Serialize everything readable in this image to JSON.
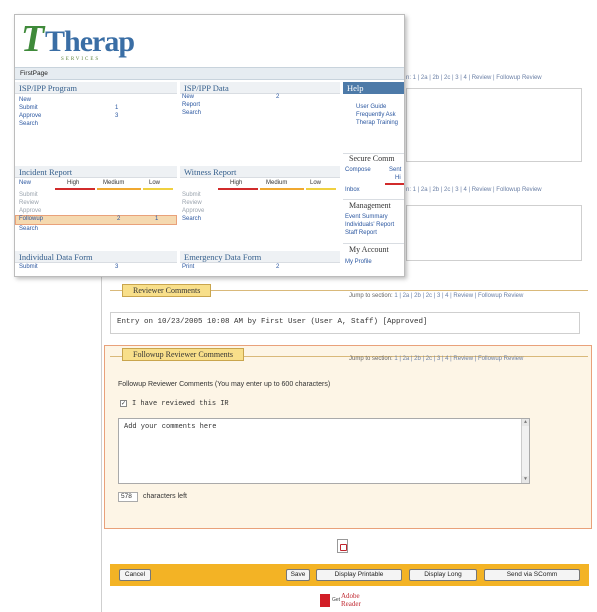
{
  "window": {
    "logo_text": "Therap",
    "logo_subtitle": "SERVICES",
    "breadcrumb": "FirstPage"
  },
  "panels": {
    "isp_program": {
      "title": "ISP/IPP Program",
      "items": [
        {
          "label": "New",
          "count": ""
        },
        {
          "label": "Submit",
          "count": "1"
        },
        {
          "label": "Approve",
          "count": "3"
        },
        {
          "label": "Search",
          "count": ""
        }
      ]
    },
    "isp_data": {
      "title": "ISP/IPP Data",
      "items": [
        {
          "label": "New",
          "count": "2"
        },
        {
          "label": "Report",
          "count": ""
        },
        {
          "label": "Search",
          "count": ""
        }
      ]
    },
    "incident_report": {
      "title": "Incident Report",
      "severity": [
        "High",
        "Medium",
        "Low"
      ],
      "items": [
        {
          "label": "New"
        },
        {
          "label": "Submit"
        },
        {
          "label": "Review"
        },
        {
          "label": "Approve"
        },
        {
          "label": "Followup",
          "high": "",
          "medium": "2",
          "low": "1"
        },
        {
          "label": "Search"
        }
      ]
    },
    "witness_report": {
      "title": "Witness Report",
      "severity": [
        "High",
        "Medium",
        "Low"
      ],
      "items": [
        {
          "label": "Submit"
        },
        {
          "label": "Review"
        },
        {
          "label": "Approve"
        },
        {
          "label": "Search"
        }
      ]
    },
    "individual_data": {
      "title": "Individual Data Form",
      "items": [
        {
          "label": "Submit",
          "count": "3"
        }
      ]
    },
    "emergency_data": {
      "title": "Emergency Data Form",
      "items": [
        {
          "label": "Print",
          "count": "2"
        }
      ]
    }
  },
  "sidebar": {
    "help": {
      "title": "Help",
      "links": [
        "User Guide",
        "Frequently Ask",
        "Therap Training"
      ]
    },
    "secure_comm": {
      "title": "Secure Comm",
      "links": [
        "Compose",
        "Sent",
        "Inbox"
      ],
      "extra": "Hi"
    },
    "management": {
      "title": "Management",
      "links": [
        "Event Summary",
        "Individuals' Report",
        "Staff Report"
      ]
    },
    "my_account": {
      "title": "My Account",
      "links": [
        "My Profile"
      ]
    }
  },
  "form": {
    "jump_prefix_partial": "n: 1 | 2a | 2b | 2c | 3 | 4 | Review | Followup Review",
    "jump_label": "Jump to section:",
    "jump_links": "1 | 2a | 2b | 2c | 3 | 4 | Review | Followup Review",
    "reviewer_comments": {
      "title": "Reviewer Comments",
      "entry": "Entry on 10/23/2005 10:08 AM by First User (User A, Staff) [Approved]"
    },
    "followup": {
      "title": "Followup Reviewer Comments",
      "instructions": "Followup Reviewer Comments (You may enter up to 600 characters)",
      "checkbox_label": "I have reviewed this IR",
      "checkbox_checked": true,
      "textarea_value": "Add your comments here",
      "chars_count": "578",
      "chars_suffix": "characters left"
    },
    "actions": {
      "cancel": "Cancel",
      "save": "Save",
      "display_printable": "Display Printable",
      "display_long": "Display Long",
      "send": "Send via SComm"
    },
    "adobe": {
      "get": "Get",
      "brand": "Adobe",
      "product": "Reader",
      "tiny": "Adobe"
    }
  },
  "colors": {
    "accent_orange": "#f3b325",
    "tab_yellow": "#f8df8a",
    "highlight_border": "#e9a17a",
    "link_blue": "#2b57a0",
    "brand_green": "#3f8a3a",
    "brand_blue": "#3a6ea5",
    "sev_high": "#d12b2b",
    "sev_medium": "#f0a830",
    "sev_low": "#f0d040"
  }
}
